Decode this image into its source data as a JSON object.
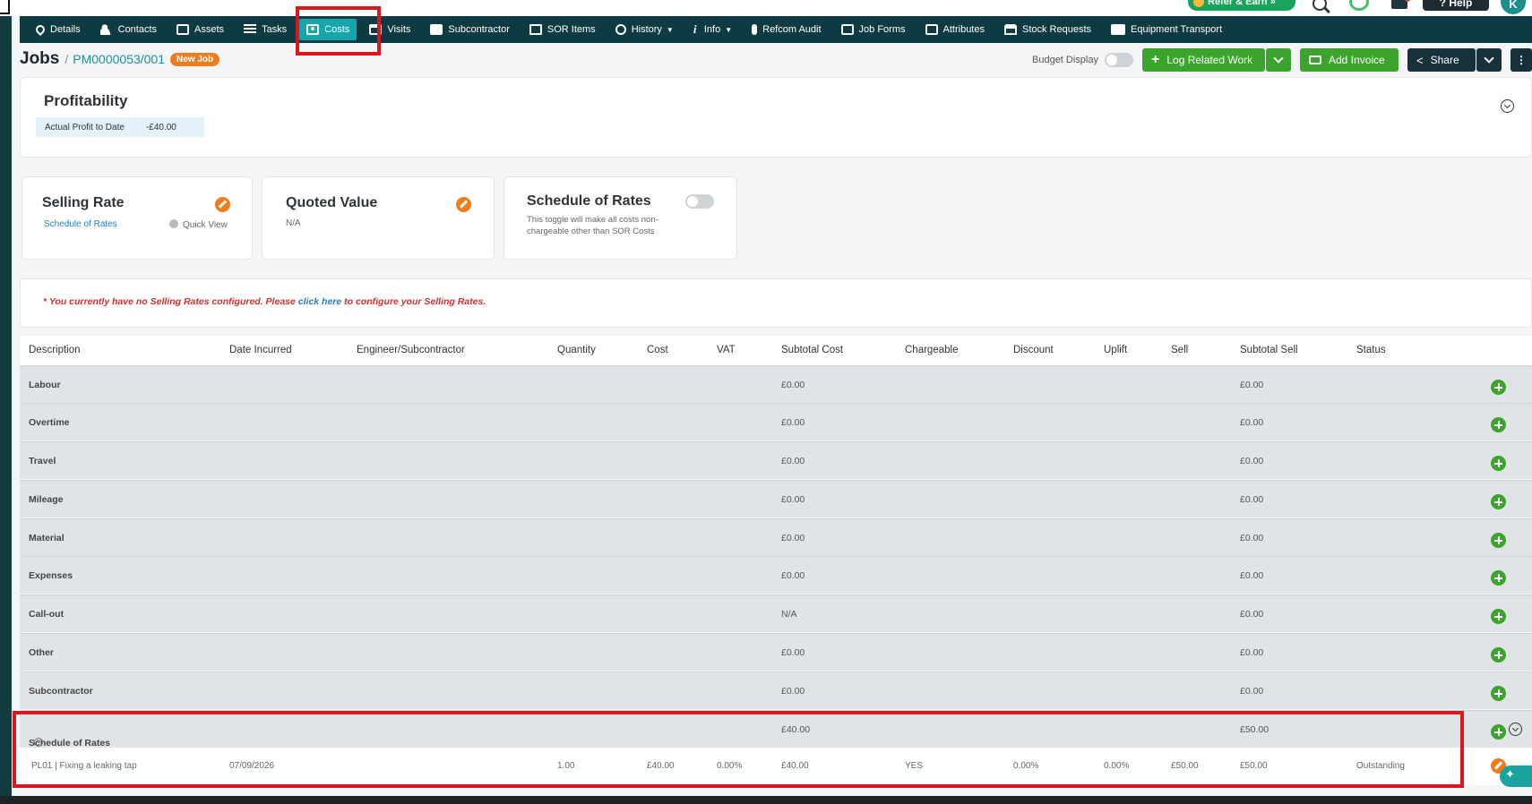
{
  "header": {
    "refer_label": "Refer & Earn »",
    "help_label": "? Help",
    "avatar_initial": "K"
  },
  "tabs": [
    {
      "label": "Details",
      "icon": "wrench-icon"
    },
    {
      "label": "Contacts",
      "icon": "people-icon"
    },
    {
      "label": "Assets",
      "icon": "box-icon"
    },
    {
      "label": "Tasks",
      "icon": "list-icon"
    },
    {
      "label": "Costs",
      "icon": "money-icon",
      "active": true
    },
    {
      "label": "Visits",
      "icon": "calendar-icon"
    },
    {
      "label": "Subcontractor",
      "icon": "id-card-icon"
    },
    {
      "label": "SOR Items",
      "icon": "book-icon"
    },
    {
      "label": "History",
      "icon": "history-icon",
      "dropdown": true
    },
    {
      "label": "Info",
      "icon": "info-icon",
      "dropdown": true
    },
    {
      "label": "Refcom Audit",
      "icon": "cylinder-icon"
    },
    {
      "label": "Job Forms",
      "icon": "form-icon"
    },
    {
      "label": "Attributes",
      "icon": "attributes-icon"
    },
    {
      "label": "Stock Requests",
      "icon": "warehouse-icon"
    },
    {
      "label": "Equipment Transport",
      "icon": "truck-icon"
    }
  ],
  "breadcrumb": {
    "root": "Jobs",
    "separator": "/",
    "job_number": "PM0000053/001",
    "status_badge": "New Job"
  },
  "actions": {
    "budget_display_label": "Budget Display",
    "log_related_work": "Log Related Work",
    "add_invoice": "Add Invoice",
    "share": "Share"
  },
  "profitability": {
    "title": "Profitability",
    "metric_label": "Actual Profit to Date",
    "metric_value": "-£40.00"
  },
  "selling_rate": {
    "title": "Selling Rate",
    "link": "Schedule of Rates",
    "quick_view": "Quick View"
  },
  "quoted_value": {
    "title": "Quoted Value",
    "value": "N/A"
  },
  "schedule_of_rates_card": {
    "title": "Schedule of Rates",
    "description": "This toggle will make all costs non-chargeable other than SOR Costs"
  },
  "warning": {
    "before": "* You currently have no Selling Rates configured. Please ",
    "link": "click here",
    "after": " to configure your Selling Rates."
  },
  "table": {
    "columns": [
      "Description",
      "Date Incurred",
      "Engineer/Subcontractor",
      "Quantity",
      "Cost",
      "VAT",
      "Subtotal Cost",
      "Chargeable",
      "Discount",
      "Uplift",
      "Sell",
      "Subtotal Sell",
      "Status"
    ],
    "groups": [
      {
        "name": "Labour",
        "subtotal_cost": "£0.00",
        "subtotal_sell": "£0.00"
      },
      {
        "name": "Overtime",
        "subtotal_cost": "£0.00",
        "subtotal_sell": "£0.00"
      },
      {
        "name": "Travel",
        "subtotal_cost": "£0.00",
        "subtotal_sell": "£0.00"
      },
      {
        "name": "Mileage",
        "subtotal_cost": "£0.00",
        "subtotal_sell": "£0.00"
      },
      {
        "name": "Material",
        "subtotal_cost": "£0.00",
        "subtotal_sell": "£0.00"
      },
      {
        "name": "Expenses",
        "subtotal_cost": "£0.00",
        "subtotal_sell": "£0.00"
      },
      {
        "name": "Call-out",
        "subtotal_cost": "N/A",
        "subtotal_sell": "£0.00"
      },
      {
        "name": "Other",
        "subtotal_cost": "£0.00",
        "subtotal_sell": "£0.00"
      },
      {
        "name": "Subcontractor",
        "subtotal_cost": "£0.00",
        "subtotal_sell": "£0.00"
      },
      {
        "name": "Schedule of Rates",
        "subtotal_cost": "£40.00",
        "subtotal_sell": "£50.00"
      }
    ],
    "sor_item": {
      "description": "PL01 | Fixing a leaking tap",
      "date_incurred": "07/09/2026",
      "quantity": "1.00",
      "cost": "£40.00",
      "vat": "0.00%",
      "subtotal_cost": "£40.00",
      "chargeable": "YES",
      "discount": "0.00%",
      "uplift": "0.00%",
      "sell": "£50.00",
      "subtotal_sell": "£50.00",
      "status": "Outstanding"
    }
  },
  "colors": {
    "tabbar": "#0e3b43",
    "active_tab": "#15a6ac",
    "accent_green": "#3aa42d",
    "badge_orange": "#ef7c1e",
    "highlight_red": "#d7191f"
  }
}
